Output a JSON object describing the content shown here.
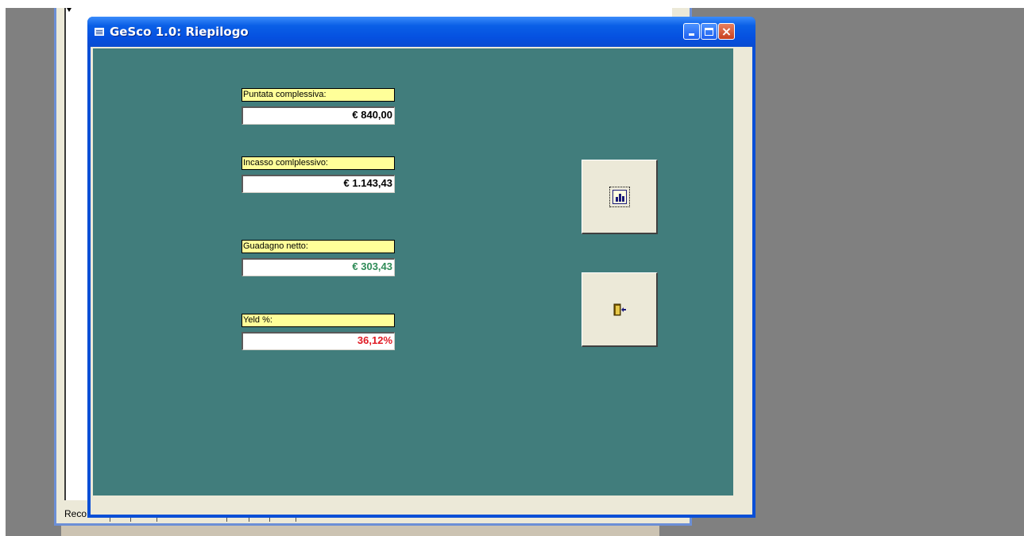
{
  "background_window": {
    "status_label": "Reco"
  },
  "dialog": {
    "title": "GeSco 1.0: Riepilogo",
    "title_icon": "form-icon",
    "controls": {
      "minimize": "minimize-icon",
      "maximize": "maximize-icon",
      "close": "×"
    }
  },
  "fields": [
    {
      "label": "Puntata complessiva:",
      "value": "€ 840,00",
      "color": "#000000"
    },
    {
      "label": "Incasso comlplessivo:",
      "value": "€ 1.143,43",
      "color": "#000000"
    },
    {
      "label": "Guadagno netto:",
      "value": "€ 303,43",
      "color": "#2e8b57"
    },
    {
      "label": "Yeld %:",
      "value": "36,12%",
      "color": "#e01b24"
    }
  ],
  "buttons": {
    "report": {
      "icon": "report-chart-icon"
    },
    "exit": {
      "icon": "exit-door-icon"
    }
  },
  "colors": {
    "detail_background": "#417d7c",
    "label_background": "#ffff99",
    "titlebar": "#0a5fe6"
  }
}
